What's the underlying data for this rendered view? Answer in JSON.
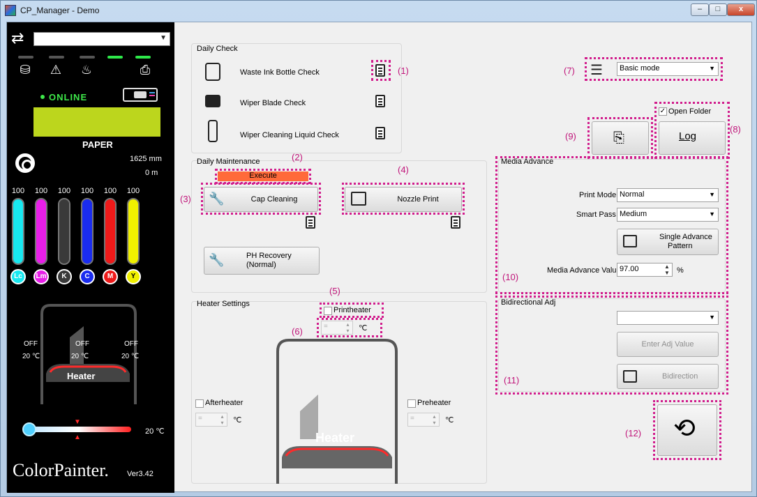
{
  "window": {
    "title": "CP_Manager - Demo",
    "min": "–",
    "max": "□",
    "close": "x"
  },
  "left": {
    "status": {
      "online": "ONLINE",
      "paper": "PAPER",
      "length_mm": "1625  mm",
      "length_m": "0  m"
    },
    "inks": [
      {
        "code": "Lc",
        "value": "100",
        "color": "#17e8f0"
      },
      {
        "code": "Lm",
        "value": "100",
        "color": "#e81ee8"
      },
      {
        "code": "K",
        "value": "100",
        "color": "#3a3a3a"
      },
      {
        "code": "C",
        "value": "100",
        "color": "#1a2cf0"
      },
      {
        "code": "M",
        "value": "100",
        "color": "#ee1a1a"
      },
      {
        "code": "Y",
        "value": "100",
        "color": "#f0f000"
      }
    ],
    "heater": {
      "label": "Heater",
      "off1": "OFF",
      "off2": "OFF",
      "off3": "OFF",
      "t1": "20 ℃",
      "t2": "20 ℃",
      "t3": "20 ℃"
    },
    "current_temp": "20 ℃",
    "logo": "ColorPainter.",
    "version": "Ver3.42"
  },
  "daily_check": {
    "title": "Daily Check",
    "items": [
      {
        "label": "Waste Ink Bottle Check"
      },
      {
        "label": "Wiper Blade Check"
      },
      {
        "label": "Wiper Cleaning Liquid Check"
      }
    ]
  },
  "daily_maintenance": {
    "title": "Daily Maintenance",
    "execute": "Execute",
    "cap_cleaning": "Cap Cleaning",
    "nozzle_print": "Nozzle Print",
    "ph_recovery_1": "PH Recovery",
    "ph_recovery_2": "(Normal)"
  },
  "heater_settings": {
    "title": "Heater Settings",
    "printheater": "Printheater",
    "afterheater": "Afterheater",
    "preheater": "Preheater",
    "unit": "℃",
    "placeholder": "=",
    "diagram_label": "Heater"
  },
  "mode": {
    "value": "Basic mode"
  },
  "open_folder": "Open Folder",
  "log_label": "Log",
  "media_advance": {
    "title": "Media Advance",
    "print_mode_label": "Print Mode",
    "print_mode": "Normal",
    "smart_pass_label": "Smart Pass",
    "smart_pass": "Medium",
    "single_advance_1": "Single Advance",
    "single_advance_2": "Pattern",
    "value_label": "Media Advance Value",
    "value": "97.00",
    "unit": "%"
  },
  "bidirectional": {
    "title": "Bidirectional Adj",
    "enter_adj": "Enter Adj Value",
    "bidirection": "Bidirection"
  },
  "callouts": {
    "c1": "(1)",
    "c2": "(2)",
    "c3": "(3)",
    "c4": "(4)",
    "c5": "(5)",
    "c6": "(6)",
    "c7": "(7)",
    "c8": "(8)",
    "c9": "(9)",
    "c10": "(10)",
    "c11": "(11)",
    "c12": "(12)"
  }
}
